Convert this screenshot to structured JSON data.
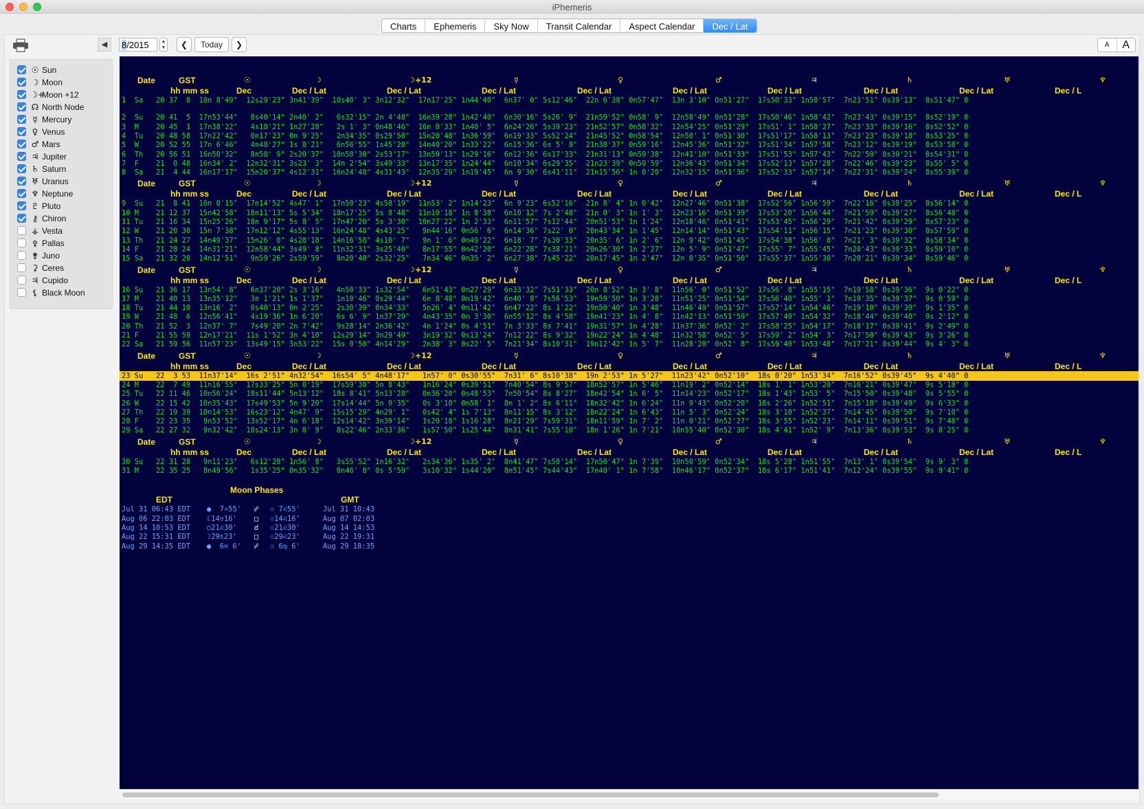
{
  "window": {
    "title": "iPhemeris",
    "controls": {
      "close": "#fc605c",
      "minimize": "#fdbc40",
      "zoom": "#34c84a"
    }
  },
  "tabs": [
    {
      "label": "Charts",
      "active": false
    },
    {
      "label": "Ephemeris",
      "active": false
    },
    {
      "label": "Sky Now",
      "active": false
    },
    {
      "label": "Transit Calendar",
      "active": false
    },
    {
      "label": "Aspect Calendar",
      "active": false
    },
    {
      "label": "Dec / Lat",
      "active": true
    }
  ],
  "toolbar": {
    "print_icon": "printer-icon",
    "collapse_label": "◀",
    "date_highlight": "8",
    "date_rest": "/2015",
    "prev_label": "❮",
    "today_label": "Today",
    "next_label": "❯",
    "font_small": "A",
    "font_large": "A"
  },
  "sidebar": {
    "items": [
      {
        "glyph": "☉",
        "label": "Sun",
        "checked": true
      },
      {
        "glyph": "☽",
        "label": "Moon",
        "checked": true
      },
      {
        "glyph": "☽+",
        "label": "Moon +12",
        "checked": true
      },
      {
        "glyph": "☊",
        "label": "North Node",
        "checked": true
      },
      {
        "glyph": "☿",
        "label": "Mercury",
        "checked": true
      },
      {
        "glyph": "♀",
        "label": "Venus",
        "checked": true
      },
      {
        "glyph": "♂",
        "label": "Mars",
        "checked": true
      },
      {
        "glyph": "♃",
        "label": "Jupiter",
        "checked": true
      },
      {
        "glyph": "♄",
        "label": "Saturn",
        "checked": true
      },
      {
        "glyph": "♅",
        "label": "Uranus",
        "checked": true
      },
      {
        "glyph": "♆",
        "label": "Neptune",
        "checked": true
      },
      {
        "glyph": "♇",
        "label": "Pluto",
        "checked": true
      },
      {
        "glyph": "⚷",
        "label": "Chiron",
        "checked": true
      },
      {
        "glyph": "⚶",
        "label": "Vesta",
        "checked": false
      },
      {
        "glyph": "⚴",
        "label": "Pallas",
        "checked": false
      },
      {
        "glyph": "⚵",
        "label": "Juno",
        "checked": false
      },
      {
        "glyph": "⚳",
        "label": "Ceres",
        "checked": false
      },
      {
        "glyph": "♃",
        "label": "Cupido",
        "checked": false
      },
      {
        "glyph": "⚸",
        "label": "Black Moon",
        "checked": false
      }
    ]
  },
  "ephemeris": {
    "header_labels": {
      "date": "Date",
      "gst": "GST",
      "hhmmss": "hh mm ss",
      "dec": "Dec",
      "declat": "Dec / Lat",
      "declat_cut": "Dec / L"
    },
    "header_glyphs": [
      "☉",
      "☽",
      "☽+12",
      "☿",
      "♀",
      "♂",
      "♃",
      "♄",
      "♅",
      "♆"
    ],
    "highlight_color": "#f5c618",
    "blocks": [
      {
        "rows": [
          "1  Sa   20 37  8  18n 8'49\"  12s29'23\" 3n41'39\"  10s40' 3\" 3n12'32\"  17n17'25\" 1n44'40\"  6n37' 0\" 5s12'46\"  22n 6'38\" 0n57'47\"  13n 3'10\" 0n51'27\"  17s50'33\" 1n58'57\"  7n23'51\" 0s39'13\"  8s51'47\" 0",
          "",
          "2  Su   20 41  5  17n53'44\"   8s40'14\" 2n40' 2\"   6s32'15\" 2n 4'48\"  16n39'28\" 1n42'40\"  6n30'16\" 5s26' 9\"  21n59'52\" 0n58' 9\"  12n58'49\" 0n51'28\"  17s50'46\" 1n58'42\"  7n23'43\" 0s39'15\"  8s52'19\" 0",
          "3  M    20 45  1  17n38'22\"   4s18'21\" 1n27'28\"   2s 1' 3\" 0n48'46\"  16n 0'33\" 1n40' 5\"  6n24'26\" 5s39'23\"  21n52'57\" 0n58'32\"  12n54'25\" 0n51'29\"  17s51' 1\" 1n58'27\"  7n23'33\" 0s39'16\"  8s52'52\" 0",
          "4  Tu   20 48 58  17n22'42\"   0n17'23\" 0n 9'25\"   2n34'35\" 0s29'50\"  15n20'48\" 1n36'59\"  6n19'33\" 5s52'24\"  21n45'52\" 0n58'54\"  12n50' 1\" 0n51'30\"  17s51'17\" 1n58'13\"  7n23'23\" 0s39'18\"  8s53'25\" 0",
          "5  W    20 52 55  17n 6'46\"   4n48'27\" 1s 8'21\"   6n56'55\" 1s45'28\"  14n40'20\" 1n33'22\"  6n15'36\" 6s 5' 8\"  21n38'37\" 0n59'16\"  12n45'36\" 0n51'32\"  17s51'34\" 1n57'58\"  7n23'12\" 0s39'19\"  8s53'58\" 0",
          "6  Th   20 56 51  16n50'32\"   8n58' 9\" 2s20'37\"  10n50'30\" 2s53'17\"  13n59'13\" 1n29'16\"  6n12'36\" 6s17'33\"  21n31'13\" 0n59'38\"  12n41'10\" 0n51'33\"  17s51'53\" 1n57'43\"  7n22'59\" 0s39'21\"  8s54'31\" 0",
          "7  F    21  0 48  16n34' 2\"  12n32'31\" 3s23' 3\"  14n 2'54\" 3s49'33\"  13n17'35\" 1n24'44\"  6n10'34\" 6s29'35\"  21n23'39\" 0n59'59\"  12n36'43\" 0n51'34\"  17s52'13\" 1n57'28\"  7n22'46\" 0s39'23\"  8s55' 5\" 0",
          "8  Sa   21  4 44  16n17'17\"  15n20'37\" 4s12'31\"  16n24'48\" 4s31'43\"  12n35'29\" 1n19'45\"  6n 9'30\" 6s41'11\"  21n15'56\" 1n 0'20\"  12n32'15\" 0n51'36\"  17s52'33\" 1n57'14\"  7n22'31\" 0s39'24\"  8s55'39\" 0"
        ]
      },
      {
        "rows": [
          "9  Su   21  8 41  16n 0'15\"  17n14'52\" 4s47' 1\"  17n50'23\" 4s58'19\"  11n53' 2\" 1n14'23\"  6n 9'23\" 6s52'16\"  21n 8' 4\" 1n 0'42\"  12n27'46\" 0n51'38\"  17s52'56\" 1n56'59\"  7n22'16\" 0s39'25\"  8s56'14\" 0",
          "10 M    21 12 37  15n42'58\"  18n11'13\" 5s 5'34\"  18n17'25\" 5s 8'48\"  11n10'18\" 1n 8'38\"  6n10'12\" 7s 2'48\"  21n 0' 3\" 1n 1' 3\"  12n23'16\" 0n51'39\"  17s53'20\" 1n56'44\"  7n21'59\" 0s39'27\"  8s56'48\" 0",
          "11 Tu   21 16 34  15n25'26\"  18n 9'17\" 5s 8' 5\"  17n47'20\" 5s 3'30\"  10n27'22\" 1n 2'33\"  6n11'57\" 7s12'44\"  20n51'53\" 1n 1'24\"  12n18'46\" 0n51'41\"  17s53'45\" 1n56'29\"  7n21'42\" 0s39'29\"  8s57'23\" 0",
          "12 W    21 20 30  15n 7'38\"  17n12'12\" 4s55'13\"  16n24'48\" 4s43'25\"   9n44'16\" 0n56' 6\"  6n14'36\" 7s22' 0\"  20n43'34\" 1n 1'45\"  12n14'14\" 0n51'43\"  17s54'11\" 1n56'15\"  7n21'23\" 0s39'30\"  8s57'59\" 0",
          "13 Th   21 24 27  14n49'37\"  15n26' 0\" 4s28'18\"  14n16'58\" 4s10' 7\"   9n 1' 6\" 0n49'22\"  6n18' 7\" 7s30'33\"  20n35' 6\" 1n 2' 6\"  12n 9'42\" 0n51'45\"  17s54'38\" 1n56' 0\"  7n21' 3\" 0s39'32\"  8s58'34\" 0",
          "14 F    21 28 24  14n31'21\"  12n58'44\" 3s49' 8\"  11n32'31\" 3s25'40\"   8n17'55\" 0n42'20\"  6n22'28\" 7s38'21\"  20n26'30\" 1n 2'27\"  12n 5' 9\" 0n51'47\"  17s55' 7\" 1n55'45\"  7n20'43\" 0s39'33\"  8s59'10\" 0",
          "15 Sa   21 32 20  14n12'51\"   9n59'26\" 2s59'59\"   8n20'40\" 2s32'25\"   7n34'46\" 0n35' 2\"  6n27'38\" 7s45'22\"  20n17'45\" 1n 2'47\"  12n 0'35\" 0n51'50\"  17s55'37\" 1n55'30\"  7n20'21\" 0s39'34\"  8s59'46\" 0"
        ]
      },
      {
        "rows": [
          "16 Su   21 36 17  13n54' 8\"   6n37'20\" 2s 3'16\"   4n50'33\" 1s32'54\"   6n51'43\" 0n27'29\"  6n33'32\" 7s51'33\"  20n 8'52\" 1n 3' 8\"  11n56' 0\" 0n51'52\"  17s56' 8\" 1n55'15\"  7n19'58\" 0s39'36\"  9s 0'22\" 0",
          "17 M    21 40 13  13n35'12\"   3n 1'21\" 1s 1'37\"   1n10'46\" 0s29'44\"   6n 8'48\" 0n19'42\"  6n40' 8\" 7s56'53\"  19n59'50\" 1n 3'28\"  11n51'25\" 0n51'54\"  17s56'40\" 1n55' 1\"  7n19'35\" 0s39'37\"  9s 0'59\" 0",
          "18 Tu   21 44 10  13n16' 2\"   0s40'13\" 0n 2'25\"   2s30'39\" 0n34'33\"   5n26' 4\" 0n11'42\"  6n47'22\" 8s 1'22\"  19n50'40\" 1n 3'48\"  11n46'49\" 0n51'57\"  17s57'14\" 1n54'46\"  7n19'10\" 0s39'39\"  9s 1'35\" 0",
          "19 W    21 48  6  12n56'41\"   4s19'36\" 1n 6'20\"   6s 6' 9\" 1n37'29\"   4n43'35\" 0n 3'30\"  6n55'12\" 8s 4'58\"  19n41'23\" 1n 4' 8\"  11n42'13\" 0n51'59\"  17s57'49\" 1n54'32\"  7n18'44\" 0s39'40\"  9s 2'12\" 0",
          "20 Th   21 52  3  12n37' 7\"   7s49'20\" 2n 7'42\"   9s28'14\" 2n36'42\"   4n 1'24\" 0s 4'51\"  7n 3'33\" 8s 7'41\"  19n31'57\" 1n 4'28\"  11n37'36\" 0n52' 2\"  17s58'25\" 1n54'17\"  7n18'17\" 0s39'41\"  9s 2'49\" 0",
          "21 F    21 55 59  12n17'21\"  11s 1'52\" 3n 4'10\"  12s29'14\" 3n29'49\"   3n19'32\" 0s13'24\"  7n12'22\" 8s 9'32\"  19n22'24\" 1n 4'48\"  11n32'58\" 0n52' 5\"  17s59' 2\" 1n54' 3\"  7n17'50\" 0s39'43\"  9s 3'26\" 0",
          "22 Sa   21 59 56  11n57'23\"  13s49'15\" 3n53'22\"  15s 0'50\" 4n14'29\"   2n38' 3\" 0s22' 5\"  7n21'34\" 8s10'31\"  19n12'42\" 1n 5' 7\"  11n28'20\" 0n52' 8\"  17s59'40\" 1n53'48\"  7n17'21\" 0s39'44\"  9s 4' 3\" 0"
        ]
      },
      {
        "highlight": 0,
        "rows": [
          "23 Su   22  3 53  11n37'14\"  16s 2'51\" 4n32'54\"  16s54' 5\" 4n48'17\"   1n57' 0\" 0s30'55\"  7n31' 6\" 8s10'38\"  19n 2'53\" 1n 5'27\"  11n23'42\" 0n52'10\"  18s 0'20\" 1n53'34\"  7n16'52\" 0s39'45\"  9s 4'40\" 0",
          "24 M    22  7 49  11n16'55\"  17s33'25\" 5n 0'19\"  17s59'38\" 5n 8'43\"   1n16'24\" 0s39'51\"  7n40'54\" 8s 9'57\"  18n52'57\" 1n 5'46\"  11n19' 2\" 0n52'14\"  18s 1' 1\" 1n53'20\"  7n16'21\" 0s39'47\"  9s 5'18\" 0",
          "25 Tu   22 11 46  10n56'24\"  18s11'44\" 5n13'12\"  18s 8'41\" 5n13'28\"   0n36'20\" 0s48'53\"  7n50'54\" 8s 8'27\"  18n42'54\" 1n 6' 5\"  11n14'23\" 0n52'17\"  18s 1'43\" 1n53' 5\"  7n15'50\" 0s39'48\"  9s 5'55\" 0",
          "26 W    22 15 42  10n35'43\"  17s49'53\" 5n 9'20\"  17s14'44\" 5n 0'35\"   0s 3'10\" 0n58' 1\"  8n 1' 2\" 8s 6'11\"  18n32'42\" 1n 6'24\"  11n 9'43\" 0n52'20\"  18s 2'26\" 1n52'51\"  7n15'18\" 0s39'49\"  9s 6'33\" 0",
          "27 Th   22 19 39  10n14'53\"  16s23'12\" 4n47' 9\"  15s15'29\" 4n29' 1\"   0s42' 4\" 1s 7'13\"  8n11'15\" 8s 3'12\"  18n22'24\" 1n 6'43\"  11n 5' 3\" 0n52'24\"  18s 3'10\" 1n52'37\"  7n14'45\" 0s39'50\"  9s 7'10\" 0",
          "28 F    22 23 35   9n53'52\"  13s52'17\" 4n 6'18\"  12s14'42\" 3n39'14\"   1s20'18\" 1s16'28\"  8n21'29\" 7s59'31\"  18n11'59\" 1n 7' 2\"  11n 0'21\" 0n52'27\"  18s 3'55\" 1n52'23\"  7n14'11\" 0s39'51\"  9s 7'48\" 0",
          "29 Sa   22 27 32   9n32'42\"  10s24'13\" 3n 8' 9\"   8s22'46\" 2n33'36\"   1s57'50\" 1s25'44\"  8n31'41\" 7s55'10\"  18n 1'26\" 1n 7'21\"  10n55'40\" 0n52'30\"  18s 4'41\" 1n52' 9\"  7n13'36\" 0s39'53\"  9s 8'25\" 0"
        ]
      },
      {
        "rows": [
          "30 Su   22 31 28   9n11'23\"   6s12'28\" 1n56' 8\"   3s55'52\" 1n16'32\"   2s34'36\" 1s35' 2\"  8n41'47\" 7s50'14\"  17n50'47\" 1n 7'39\"  10n50'59\" 0n52'34\"  18s 5'28\" 1n51'55\"  7n13' 1\" 0s39'54\"  9s 9' 3\" 0",
          "31 M    22 35 25   8n49'56\"   1s35'25\" 0n35'32\"   0n46' 8\" 0s 5'59\"   3s10'32\" 1s44'20\"  8n51'45\" 7s44'43\"  17n40' 1\" 1n 7'58\"  10n46'17\" 0n52'37\"  18s 6'17\" 1n51'41\"  7n12'24\" 0s39'55\"  9s 9'41\" 0"
        ]
      }
    ]
  },
  "moon_phases": {
    "title": "Moon Phases",
    "edt_label": "EDT",
    "gmt_label": "GMT",
    "rows": [
      {
        "edt": "Jul 31 06:43 EDT",
        "phase": "●  7♒55'",
        "aspect": "☍",
        "sun": "☉ 7♌55'",
        "gmt": "Jul 31 10:43"
      },
      {
        "edt": "Aug 06 22:03 EDT",
        "phase": "☾14♉16'",
        "aspect": "□",
        "sun": "☉14♌16'",
        "gmt": "Aug 07 02:03"
      },
      {
        "edt": "Aug 14 10:53 EDT",
        "phase": "○21♌30'",
        "aspect": "☌",
        "sun": "☉21♌30'",
        "gmt": "Aug 14 14:53"
      },
      {
        "edt": "Aug 22 15:31 EDT",
        "phase": "☽29♏23'",
        "aspect": "□",
        "sun": "☉29♌23'",
        "gmt": "Aug 22 19:31"
      },
      {
        "edt": "Aug 29 14:35 EDT",
        "phase": "●  6♓ 6'",
        "aspect": "☍",
        "sun": "☉ 6♍ 6'",
        "gmt": "Aug 29 18:35"
      }
    ]
  }
}
